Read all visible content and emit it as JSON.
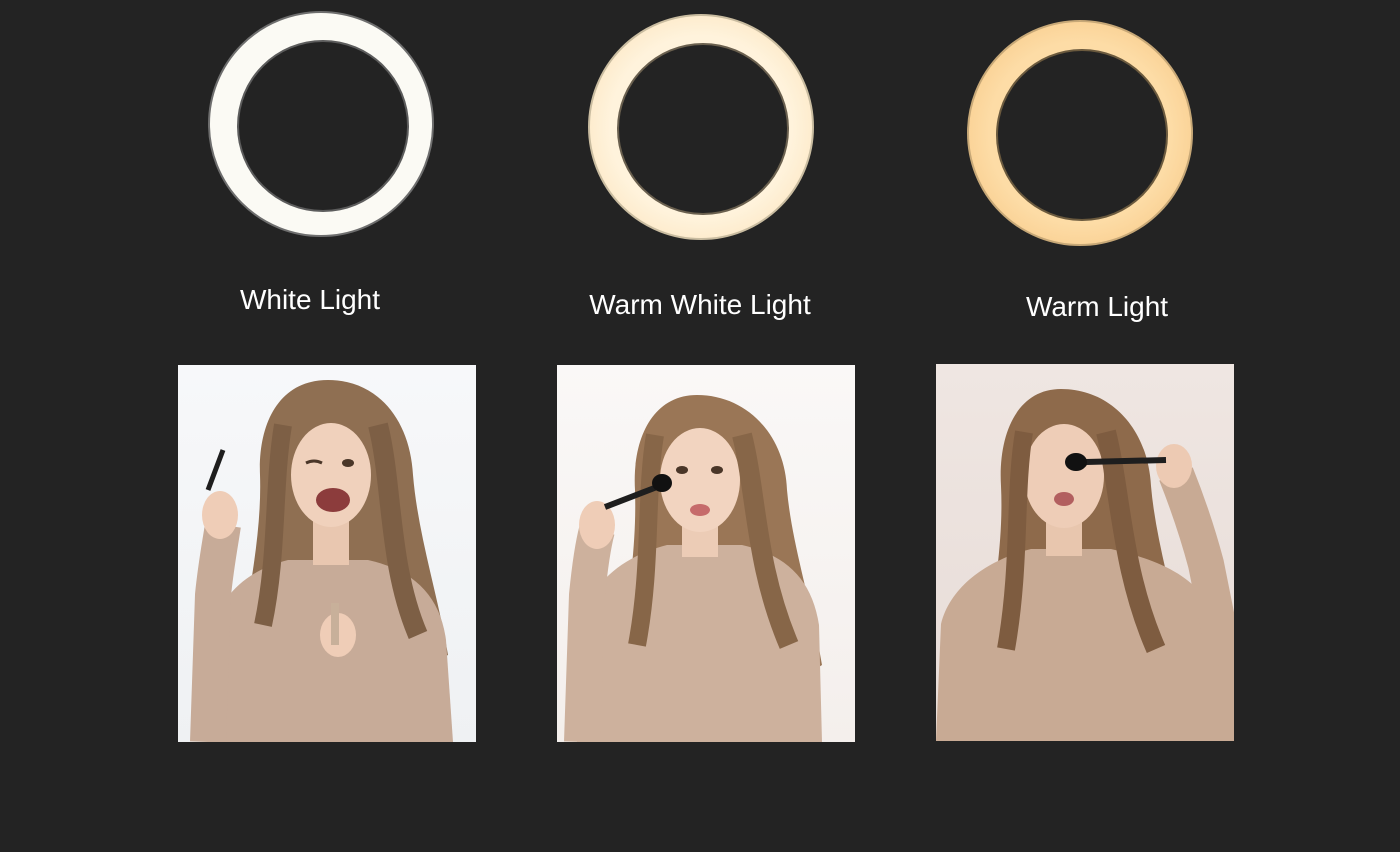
{
  "options": [
    {
      "label": "White Light",
      "ring_color": "#fbfaf4"
    },
    {
      "label": "Warm White Light",
      "ring_color": "#fff0d6"
    },
    {
      "label": "Warm Light",
      "ring_color": "#fad9a1"
    }
  ]
}
